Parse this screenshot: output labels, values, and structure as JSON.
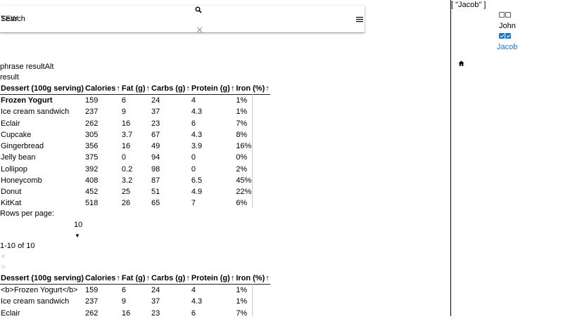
{
  "toolbar": {
    "title": "Search",
    "title_overlay": "TEW",
    "icons": {
      "search": "search-icon",
      "close": "close-icon",
      "menu": "menu-icon"
    }
  },
  "side_panel": {
    "selected_json": "[ \"Jacob\" ]",
    "users": [
      {
        "name": "John",
        "checked": false
      },
      {
        "name": "Jacob",
        "checked": true
      }
    ],
    "home_icon": "home-icon",
    "accent_color": "#1976d2"
  },
  "main": {
    "phrase_text": "phrase resultAlt",
    "result_text": "result"
  },
  "table_headers": [
    "Dessert (100g serving)",
    "Calories",
    "Fat (g)",
    "Carbs (g)",
    "Protein (g)",
    "Iron (%)"
  ],
  "table_rows": [
    [
      "Frozen Yogurt",
      "159",
      "6",
      "24",
      "4",
      "1%"
    ],
    [
      "Ice cream sandwich",
      "237",
      "9",
      "37",
      "4.3",
      "1%"
    ],
    [
      "Eclair",
      "262",
      "16",
      "23",
      "6",
      "7%"
    ],
    [
      "Cupcake",
      "305",
      "3.7",
      "67",
      "4.3",
      "8%"
    ],
    [
      "Gingerbread",
      "356",
      "16",
      "49",
      "3.9",
      "16%"
    ],
    [
      "Jelly bean",
      "375",
      "0",
      "94",
      "0",
      "0%"
    ],
    [
      "Lollipop",
      "392",
      "0.2",
      "98",
      "0",
      "2%"
    ],
    [
      "Honeycomb",
      "408",
      "3.2",
      "87",
      "6.5",
      "45%"
    ],
    [
      "Donut",
      "452",
      "25",
      "51",
      "4.9",
      "22%"
    ],
    [
      "KitKat",
      "518",
      "26",
      "65",
      "7",
      "6%"
    ]
  ],
  "table2_rows": [
    [
      "<b>Frozen Yogurt</b>",
      "159",
      "6",
      "24",
      "4",
      "1%"
    ],
    [
      "Ice cream sandwich",
      "237",
      "9",
      "37",
      "4.3",
      "1%"
    ],
    [
      "Eclair",
      "262",
      "16",
      "23",
      "6",
      "7%"
    ]
  ],
  "pagination": {
    "rows_per_page_label": "Rows per page:",
    "rows_per_page_value": "10",
    "range_text": "1-10 of 10",
    "prev": "<",
    "next": ">"
  }
}
